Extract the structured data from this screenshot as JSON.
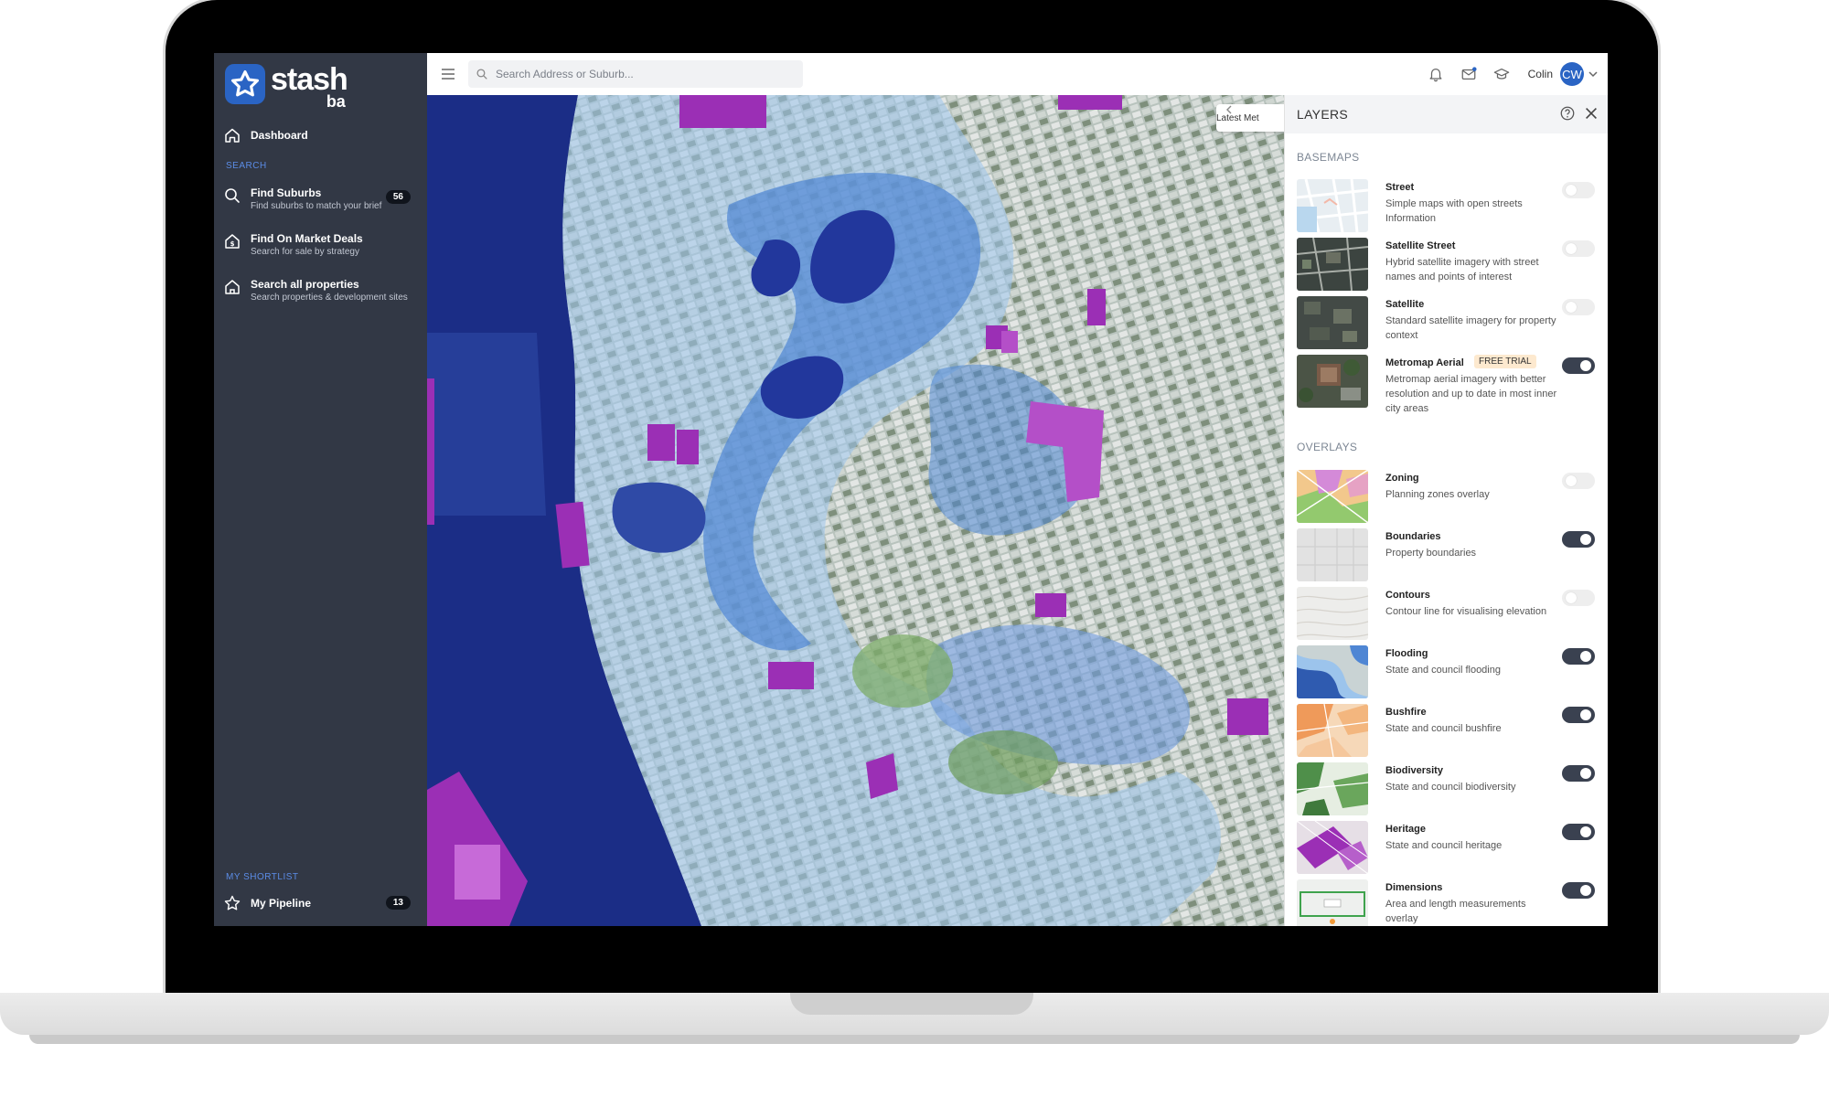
{
  "brand": {
    "name": "stash",
    "sub": "ba"
  },
  "sidebar": {
    "dashboard": "Dashboard",
    "search_heading": "SEARCH",
    "items": [
      {
        "title": "Find Suburbs",
        "sub": "Find suburbs to match your brief",
        "count": "56",
        "icon": "search-icon"
      },
      {
        "title": "Find On Market Deals",
        "sub": "Search for sale by strategy",
        "icon": "house-dollar-icon"
      },
      {
        "title": "Search all properties",
        "sub": "Search properties & development sites",
        "icon": "house-icon"
      }
    ],
    "shortlist_heading": "MY SHORTLIST",
    "pipeline": {
      "title": "My Pipeline",
      "count": "13"
    }
  },
  "topbar": {
    "search_placeholder": "Search Address or Suburb...",
    "user_name": "Colin",
    "user_initials": "CW"
  },
  "map": {
    "latest_tab": "Latest Met"
  },
  "layers": {
    "title": "LAYERS",
    "basemaps_label": "BASEMAPS",
    "overlays_label": "OVERLAYS",
    "basemaps": [
      {
        "name": "Street",
        "desc": "Simple maps with open streets Information",
        "enabled": false
      },
      {
        "name": "Satellite Street",
        "desc": "Hybrid satellite imagery with street names and points of interest",
        "enabled": false
      },
      {
        "name": "Satellite",
        "desc": "Standard satellite imagery for property context",
        "enabled": false
      },
      {
        "name": "Metromap Aerial",
        "badge": "FREE TRIAL",
        "desc": "Metromap aerial imagery with better resolution and up to date in most inner city areas",
        "enabled": true
      }
    ],
    "overlays": [
      {
        "name": "Zoning",
        "desc": "Planning zones overlay",
        "enabled": false
      },
      {
        "name": "Boundaries",
        "desc": "Property boundaries",
        "enabled": true
      },
      {
        "name": "Contours",
        "desc": "Contour line for visualising elevation",
        "enabled": false
      },
      {
        "name": "Flooding",
        "desc": "State and council flooding",
        "enabled": true
      },
      {
        "name": "Bushfire",
        "desc": "State and council bushfire",
        "enabled": true
      },
      {
        "name": "Biodiversity",
        "desc": "State and council biodiversity",
        "enabled": true
      },
      {
        "name": "Heritage",
        "desc": "State and council heritage",
        "enabled": true
      },
      {
        "name": "Dimensions",
        "desc": "Area and length measurements overlay",
        "enabled": true
      }
    ]
  },
  "colors": {
    "sidebar_bg": "#323845",
    "accent": "#2a64c4",
    "flood_deep": "#1b2d86",
    "flood_mid": "#4f86d4",
    "flood_light": "#9cc4ec",
    "heritage": "#9b2fb5"
  }
}
